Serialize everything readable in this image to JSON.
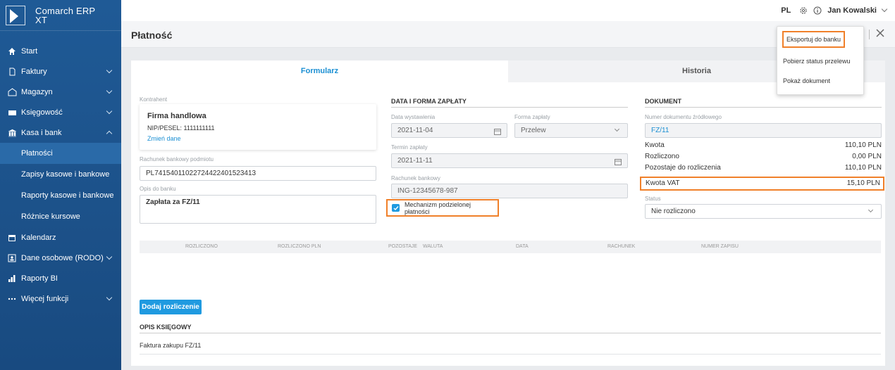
{
  "app": {
    "logo_line1": "Comarch ERP",
    "logo_line2": "XT"
  },
  "sidebar": {
    "items": [
      {
        "label": "Start",
        "icon": "home-icon"
      },
      {
        "label": "Faktury",
        "icon": "document-icon"
      },
      {
        "label": "Magazyn",
        "icon": "warehouse-icon"
      },
      {
        "label": "Księgowość",
        "icon": "accounting-icon"
      },
      {
        "label": "Kasa i bank",
        "icon": "bank-icon"
      }
    ],
    "subitems": [
      "Płatności",
      "Zapisy kasowe i bankowe",
      "Raporty kasowe i bankowe",
      "Różnice kursowe"
    ],
    "items2": [
      {
        "label": "Kalendarz",
        "icon": "calendar-icon"
      },
      {
        "label": "Dane osobowe (RODO)",
        "icon": "id-card-icon"
      },
      {
        "label": "Raporty BI",
        "icon": "bar-chart-icon"
      },
      {
        "label": "Więcej funkcji",
        "icon": "more-icon"
      }
    ]
  },
  "topbar": {
    "lang": "PL",
    "user": "Jan Kowalski"
  },
  "page": {
    "title": "Płatność"
  },
  "tabs": [
    "Formularz",
    "Historia"
  ],
  "contractor": {
    "label": "Kontrahent",
    "name": "Firma handlowa",
    "nip": "NIP/PESEL: 1111111111",
    "change": "Zmień dane",
    "account_label": "Rachunek bankowy podmiotu",
    "account": "PL74154011022724422401523413",
    "desc_label": "Opis do banku",
    "desc": "Zapłata za FZ/11"
  },
  "payment": {
    "section": "DATA I FORMA ZAPŁATY",
    "issue_label": "Data wystawienia",
    "issue": "2021-11-04",
    "form_label": "Forma zapłaty",
    "form": "Przelew",
    "due_label": "Termin zapłaty",
    "due": "2021-11-11",
    "bank_label": "Rachunek bankowy",
    "bank": "ING-12345678-987",
    "split_label": "Mechanizm podzielonej płatności",
    "split_checked": true
  },
  "document": {
    "section": "DOKUMENT",
    "source_label": "Numer dokumentu źródłowego",
    "source": "FZ/11",
    "rows": [
      {
        "k": "Kwota",
        "v": "110,10 PLN"
      },
      {
        "k": "Rozliczono",
        "v": "0,00 PLN"
      },
      {
        "k": "Pozostaje do rozliczenia",
        "v": "110,10 PLN"
      },
      {
        "k": "Kwota VAT",
        "v": "15,10 PLN"
      }
    ],
    "status_label": "Status",
    "status": "Nie rozliczono"
  },
  "grid": {
    "columns": [
      "ROZLICZONO",
      "ROZLICZONO PLN",
      "POZOSTAJE",
      "WALUTA",
      "DATA",
      "RACHUNEK",
      "NUMER ZAPISU"
    ]
  },
  "add_button": "Dodaj rozliczenie",
  "accounting": {
    "section": "OPIS KSIĘGOWY",
    "text": "Faktura zakupu FZ/11"
  },
  "menu": [
    "Eksportuj do banku",
    "Pobierz status przelewu",
    "Pokaż dokument"
  ],
  "colors": {
    "sidebar": "#1c5189",
    "accent": "#1a8fd3",
    "highlight": "#f0802a"
  }
}
